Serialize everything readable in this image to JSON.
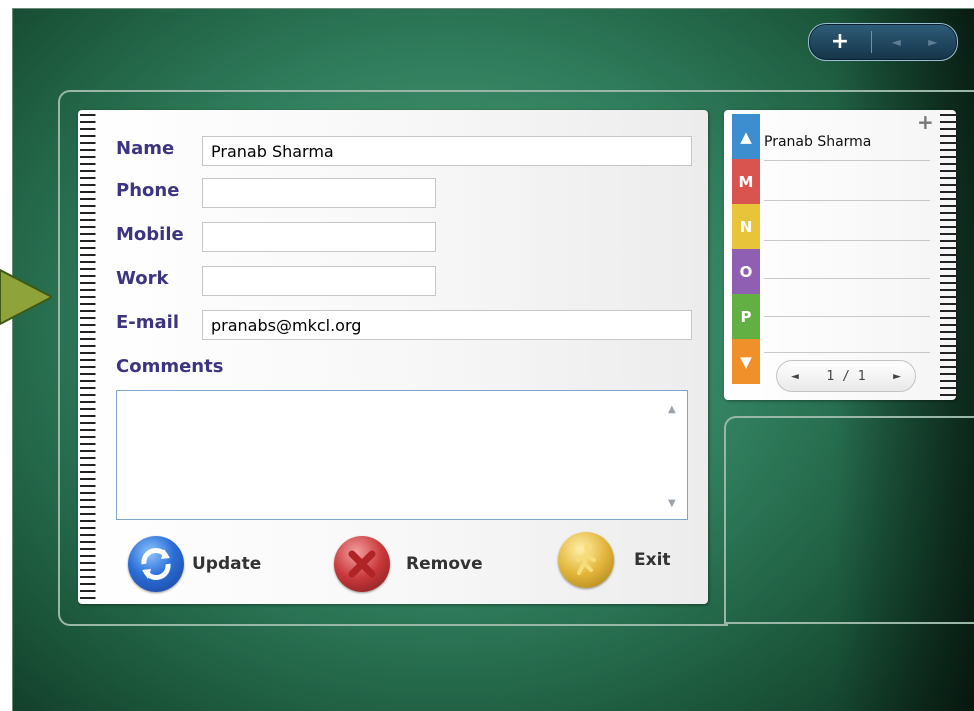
{
  "toolbar": {
    "add_icon": "+",
    "prev_icon": "◄",
    "next_icon": "►"
  },
  "form": {
    "name_label": "Name",
    "name_value": "Pranab Sharma",
    "phone_label": "Phone",
    "phone_value": "",
    "mobile_label": "Mobile",
    "mobile_value": "",
    "work_label": "Work",
    "work_value": "",
    "email_label": "E-mail",
    "email_value": "pranabs@mkcl.org",
    "comments_label": "Comments",
    "comments_value": ""
  },
  "actions": {
    "update_label": "Update",
    "remove_label": "Remove",
    "exit_label": "Exit"
  },
  "index": {
    "tabs": [
      {
        "letter": "▲",
        "color": "#3d8ecf"
      },
      {
        "letter": "M",
        "color": "#d9534f"
      },
      {
        "letter": "N",
        "color": "#e8c43a"
      },
      {
        "letter": "O",
        "color": "#8e5fb2"
      },
      {
        "letter": "P",
        "color": "#62b044"
      },
      {
        "letter": "▼",
        "color": "#f0902a"
      }
    ],
    "entries": [
      "Pranab Sharma"
    ],
    "add_icon": "+",
    "pager_text": "1 / 1",
    "pager_prev": "◄",
    "pager_next": "►"
  },
  "colors": {
    "label": "#3c3480",
    "background": "#2f7d5c",
    "update": "#2b6fd6",
    "remove": "#c8383a",
    "exit": "#e2b53a"
  }
}
